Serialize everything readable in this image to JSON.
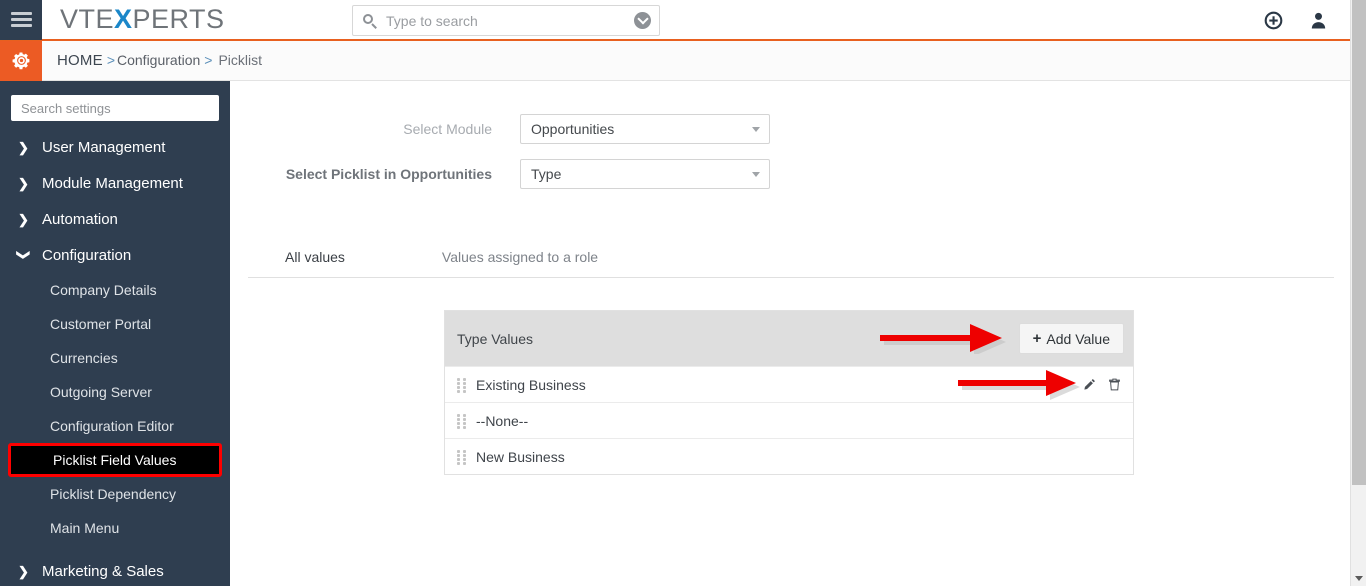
{
  "topbar": {
    "hamburger_icon": "hamburger-menu-icon",
    "brand_part1": "VTE",
    "brand_x": "X",
    "brand_part2": "PERTS",
    "search_placeholder": "Type to search",
    "search_value": "",
    "search_icon": "search-icon",
    "search_dropdown_icon": "chevron-down-circle-icon",
    "quick_create_icon": "plus-circle-icon",
    "user_icon": "user-icon",
    "accent_color": "#e8601f"
  },
  "breadcrumb": {
    "gear_icon": "gear-icon",
    "home": "HOME",
    "sep1": ">",
    "configuration": "Configuration",
    "sep2": ">",
    "picklist": "Picklist"
  },
  "sidebar": {
    "search_placeholder": "Search settings",
    "search_value": "",
    "background_color": "#2f3e50",
    "groups": [
      {
        "label": "User Management",
        "icon": "chevron-right-icon",
        "expanded": false
      },
      {
        "label": "Module Management",
        "icon": "chevron-right-icon",
        "expanded": false
      },
      {
        "label": "Automation",
        "icon": "chevron-right-icon",
        "expanded": false
      },
      {
        "label": "Configuration",
        "icon": "chevron-down-icon",
        "expanded": true
      }
    ],
    "configuration_items": [
      {
        "label": "Company Details",
        "active": false
      },
      {
        "label": "Customer Portal",
        "active": false
      },
      {
        "label": "Currencies",
        "active": false
      },
      {
        "label": "Outgoing Server",
        "active": false
      },
      {
        "label": "Configuration Editor",
        "active": false
      },
      {
        "label": "Picklist Field Values",
        "active": true
      },
      {
        "label": "Picklist Dependency",
        "active": false
      },
      {
        "label": "Main Menu",
        "active": false
      }
    ],
    "bottom_group": {
      "label": "Marketing & Sales",
      "icon": "chevron-right-icon"
    },
    "highlight_color": "#ff0000"
  },
  "main": {
    "fields": [
      {
        "label": "Select Module",
        "value": "Opportunities",
        "emphasis": false
      },
      {
        "label": "Select Picklist in Opportunities",
        "value": "Type",
        "emphasis": true
      }
    ],
    "tabs": [
      {
        "label": "All values",
        "active": true
      },
      {
        "label": "Values assigned to a role",
        "active": false
      }
    ],
    "panel": {
      "title": "Type Values",
      "add_button_plus": "+",
      "add_button_label": "Add Value",
      "rows": [
        {
          "label": "Existing Business",
          "has_actions": true,
          "drag_icon": "drag-handle-icon",
          "edit_icon": "pencil-icon",
          "delete_icon": "trash-icon"
        },
        {
          "label": "--None--",
          "has_actions": false,
          "drag_icon": "drag-handle-icon"
        },
        {
          "label": "New Business",
          "has_actions": false,
          "drag_icon": "drag-handle-icon"
        }
      ]
    },
    "annotations": [
      {
        "name": "arrow-to-add-value",
        "color": "#ee0000"
      },
      {
        "name": "arrow-to-row-edit",
        "color": "#ee0000"
      }
    ]
  },
  "scrollbar": {
    "orientation": "vertical",
    "down_arrow_icon": "caret-down-icon"
  }
}
